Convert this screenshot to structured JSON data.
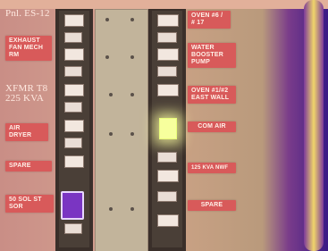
{
  "labels": {
    "panel_title": "Pnl. ES-12",
    "exhaust_fan": "EXHAUST FAN MECH RM",
    "xfmr": "XFMR T8 225 KVA",
    "air_dryer": "AIR DRYER",
    "spare_left": "SPARE",
    "sol_sor": "50 SOL ST SOR",
    "oven_top": "OVEN #6 / # 17",
    "water_booster": "WATER BOOSTER PUMP",
    "oven_east": "OVEN #1/#2 EAST WALL",
    "com_air": "COM AIR",
    "kva": "125 KVA NWF",
    "spare_right": "SPARE"
  },
  "colors": {
    "label_red": "#d85a5a",
    "glow": "#f7ff9d",
    "background": "#c98e86",
    "purple": "#3a1a86"
  }
}
